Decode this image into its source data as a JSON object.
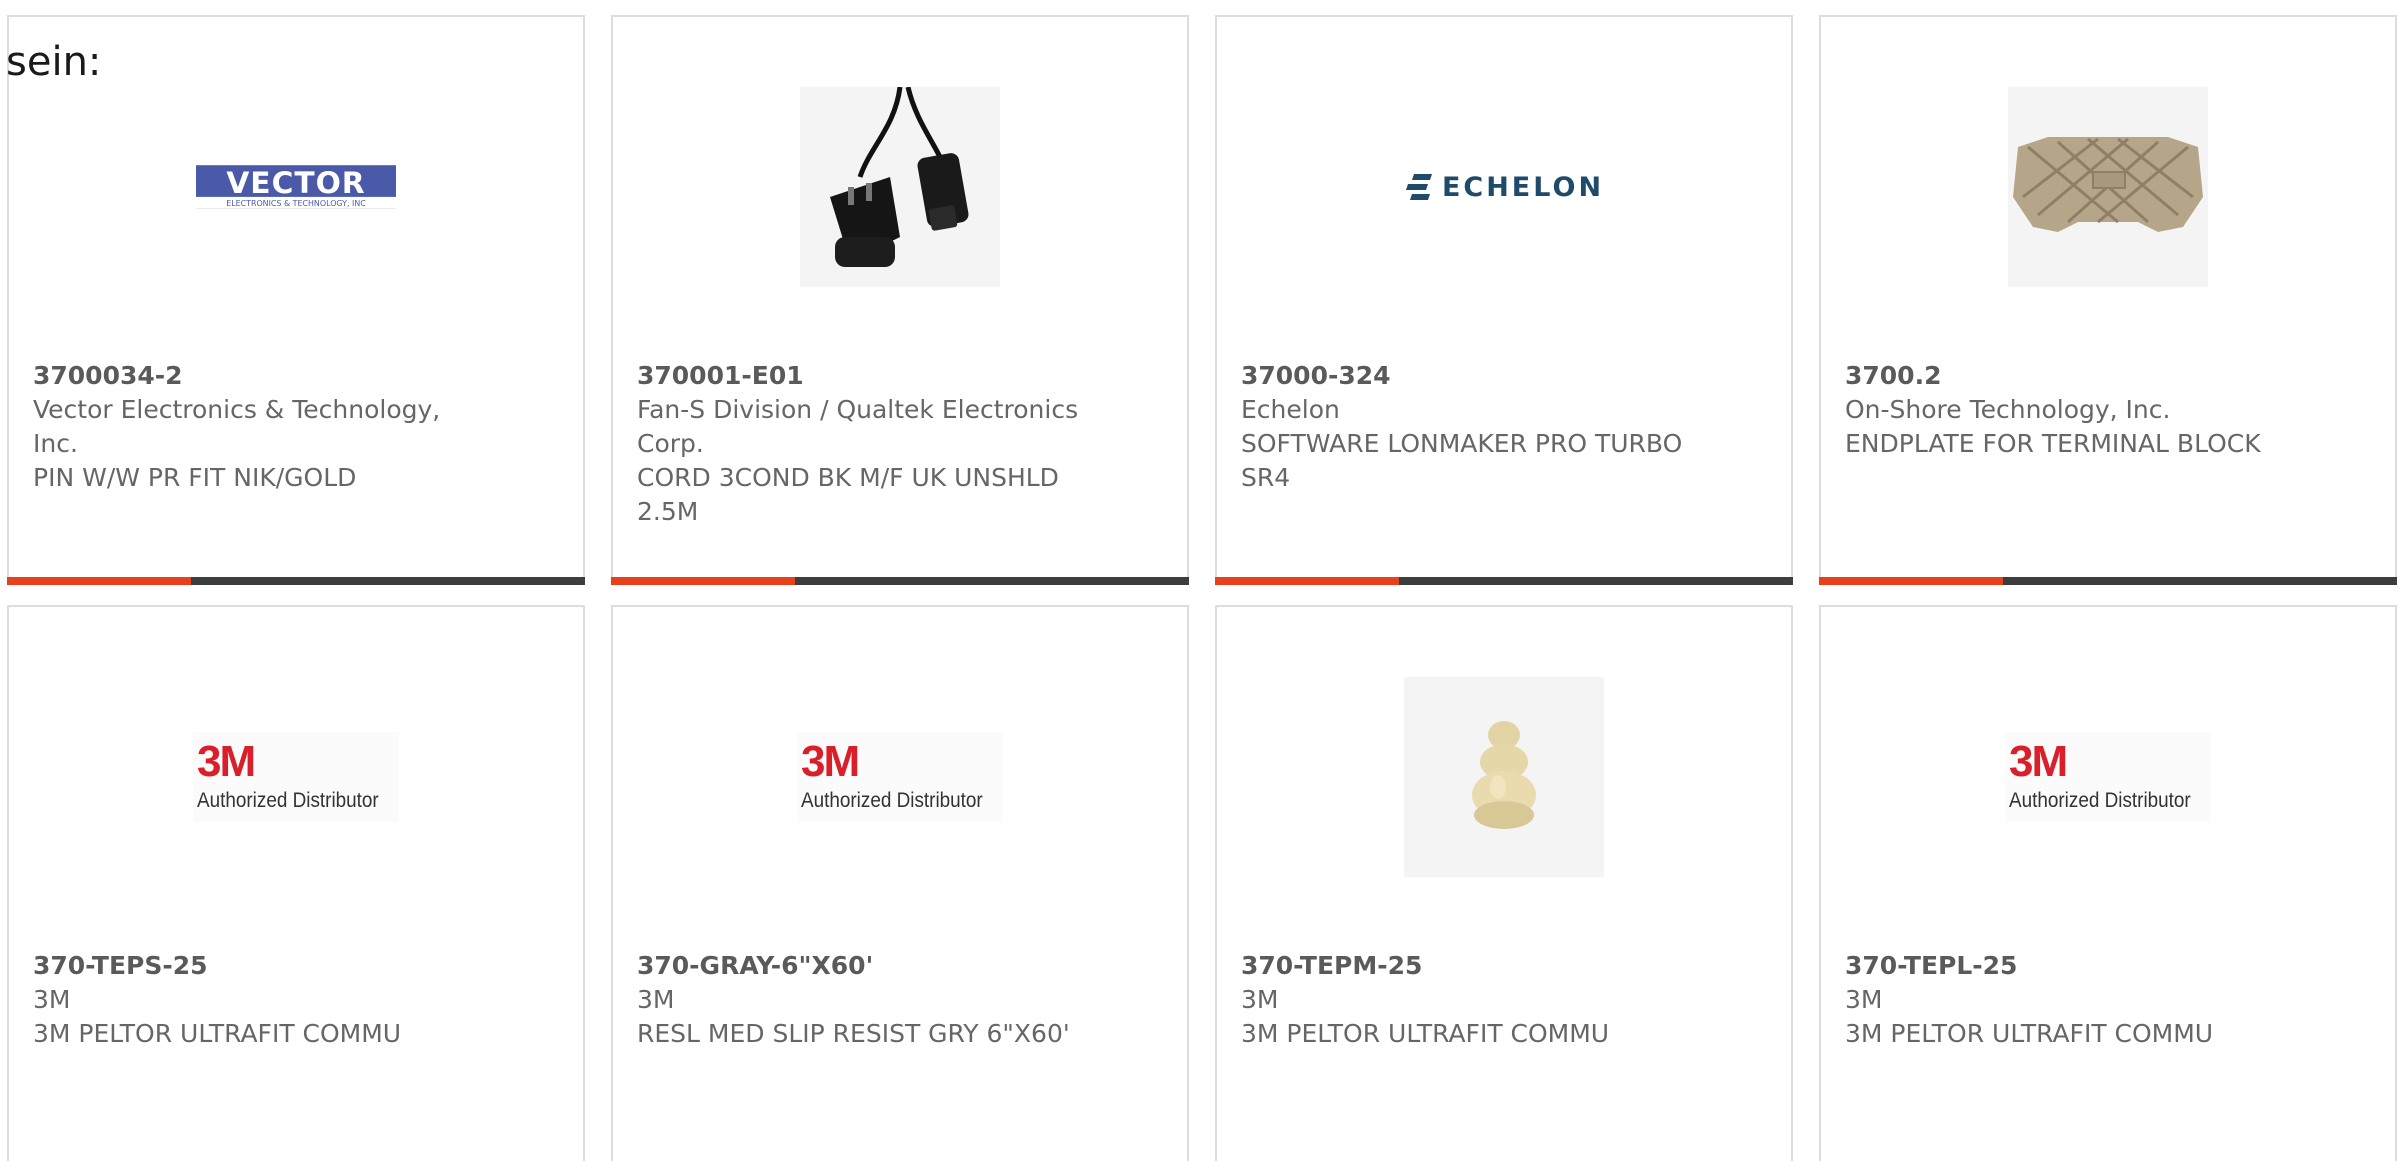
{
  "lead_text": "sein:",
  "colors": {
    "accent": "#e8401c",
    "bar": "#3d3d3d",
    "border": "#dddddd",
    "text": "#666666"
  },
  "products": [
    {
      "part_number": "3700034-2",
      "manufacturer": "Vector Electronics & Technology, Inc.",
      "description": "PIN W/W PR FIT NIK/GOLD",
      "image": "vector-logo"
    },
    {
      "part_number": "370001-E01",
      "manufacturer": "Fan-S Division / Qualtek Electronics Corp.",
      "description": "CORD 3COND BK M/F UK UNSHLD 2.5M",
      "image": "power-cord-photo"
    },
    {
      "part_number": "37000-324",
      "manufacturer": "Echelon",
      "description": "SOFTWARE LONMAKER PRO TURBO SR4",
      "image": "echelon-logo",
      "logo_text": "ECHELON"
    },
    {
      "part_number": "3700.2",
      "manufacturer": "On-Shore Technology, Inc.",
      "description": "ENDPLATE FOR TERMINAL BLOCK",
      "image": "endplate-photo"
    },
    {
      "part_number": "370-TEPS-25",
      "manufacturer": "3M",
      "description": "3M PELTOR ULTRAFIT COMMU",
      "image": "3m-logo",
      "logo_mark": "3M",
      "logo_sub": "Authorized Distributor"
    },
    {
      "part_number": "370-GRAY-6\"X60'",
      "manufacturer": "3M",
      "description": "RESL MED SLIP RESIST GRY 6\"X60'",
      "image": "3m-logo",
      "logo_mark": "3M",
      "logo_sub": "Authorized Distributor"
    },
    {
      "part_number": "370-TEPM-25",
      "manufacturer": "3M",
      "description": "3M PELTOR ULTRAFIT COMMU",
      "image": "eartip-photo"
    },
    {
      "part_number": "370-TEPL-25",
      "manufacturer": "3M",
      "description": "3M PELTOR ULTRAFIT COMMU",
      "image": "3m-logo",
      "logo_mark": "3M",
      "logo_sub": "Authorized Distributor"
    }
  ]
}
